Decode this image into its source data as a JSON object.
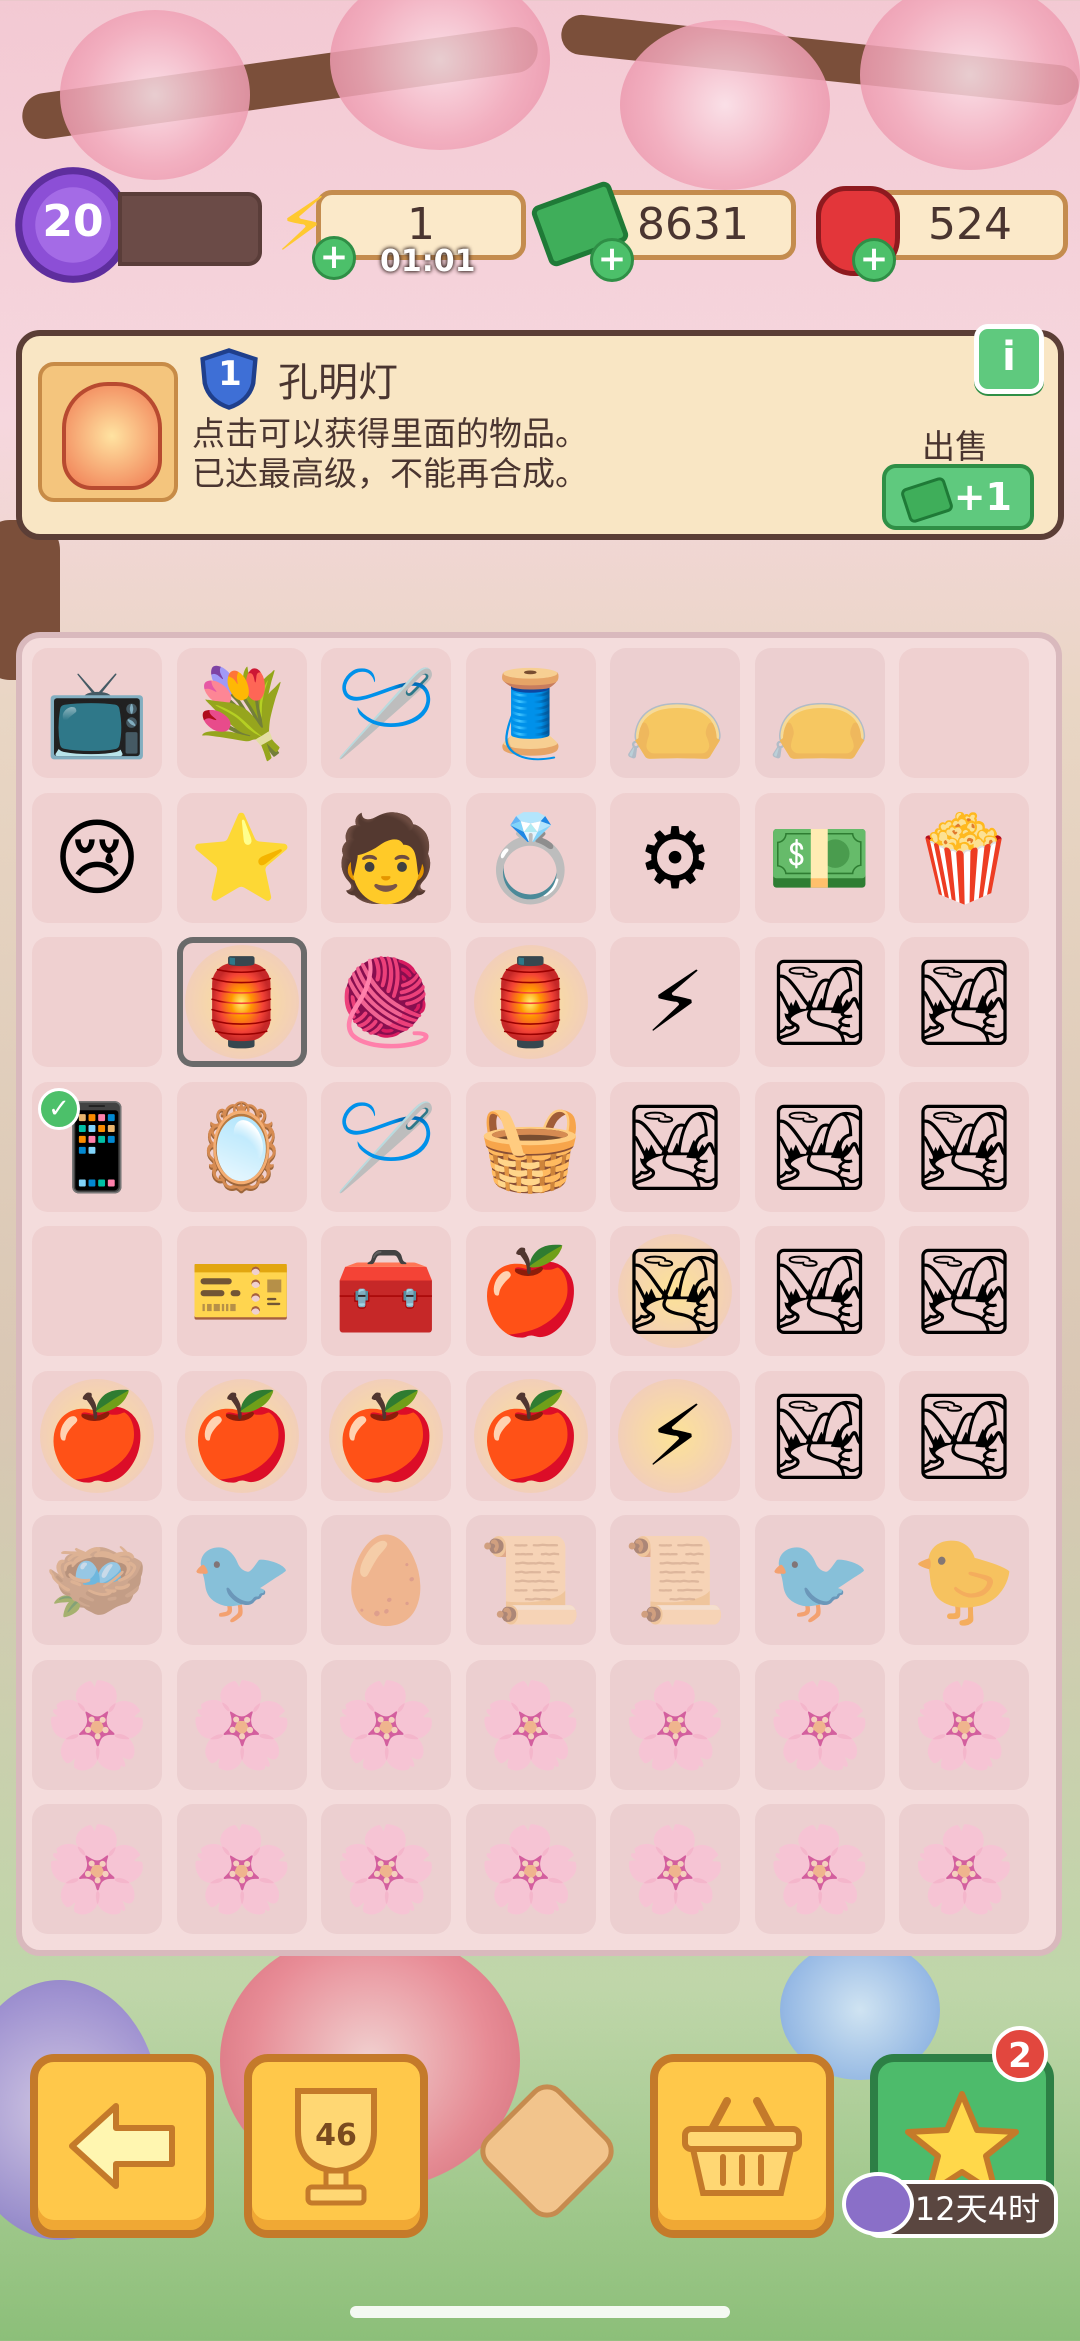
{
  "header": {
    "player_level": "20",
    "energy": "1",
    "energy_timer": "01:01",
    "cash": "8631",
    "gems": "524"
  },
  "item_info": {
    "item_level": "1",
    "name": "孔明灯",
    "desc_line1": "点击可以获得里面的物品。",
    "desc_line2": "已达最高级，不能再合成。",
    "sell_label": "出售",
    "sell_price": "+1",
    "info_button": "i"
  },
  "board": {
    "rows": [
      [
        {
          "name": "tv",
          "icon": "📺"
        },
        {
          "name": "lady-with-flowers",
          "icon": "💐"
        },
        {
          "name": "needle",
          "icon": "🪡"
        },
        {
          "name": "lady-embroidering",
          "icon": "🧵"
        },
        {
          "name": "pouch",
          "icon": "👝",
          "locked": true
        },
        {
          "name": "pouch",
          "icon": "👝",
          "locked": true
        },
        {
          "name": "empty",
          "icon": ""
        }
      ],
      [
        {
          "name": "scholar-crying",
          "icon": "😢"
        },
        {
          "name": "purple-star",
          "icon": "⭐"
        },
        {
          "name": "scholar",
          "icon": "🧑"
        },
        {
          "name": "bracelet",
          "icon": "💍"
        },
        {
          "name": "spinning-wheel",
          "icon": "⚙"
        },
        {
          "name": "cash-stack",
          "icon": "💵"
        },
        {
          "name": "popcorn",
          "icon": "🍿"
        }
      ],
      [
        {
          "name": "empty",
          "icon": ""
        },
        {
          "name": "sky-lantern",
          "icon": "🏮",
          "selected": true,
          "glow": true
        },
        {
          "name": "yarn",
          "icon": "🧶"
        },
        {
          "name": "sky-lantern",
          "icon": "🏮",
          "glow": true
        },
        {
          "name": "waterfall-energy",
          "icon": "⚡"
        },
        {
          "name": "waterfall-girl",
          "icon": "🏞"
        },
        {
          "name": "waterfall-girl",
          "icon": "🏞"
        }
      ],
      [
        {
          "name": "lady-phone",
          "icon": "📱",
          "check": true
        },
        {
          "name": "lady-mirror",
          "icon": "🪞"
        },
        {
          "name": "embroidery-hoop",
          "icon": "🪡"
        },
        {
          "name": "fruit-basket",
          "icon": "🧺"
        },
        {
          "name": "waterfall-girl",
          "icon": "🏞"
        },
        {
          "name": "waterfall-girl",
          "icon": "🏞"
        },
        {
          "name": "waterfall-girl",
          "icon": "🏞"
        }
      ],
      [
        {
          "name": "empty",
          "icon": ""
        },
        {
          "name": "ticket",
          "icon": "🎫"
        },
        {
          "name": "sewing-box",
          "icon": "🧰"
        },
        {
          "name": "fruit-plate",
          "icon": "🍎"
        },
        {
          "name": "waterfall-girl",
          "icon": "🏞",
          "glow": true
        },
        {
          "name": "waterfall-girl",
          "icon": "🏞"
        },
        {
          "name": "waterfall-girl",
          "icon": "🏞"
        }
      ],
      [
        {
          "name": "fruit-plate",
          "icon": "🍎",
          "glow": true
        },
        {
          "name": "fruit-plate",
          "icon": "🍎",
          "glow": true
        },
        {
          "name": "fruit-plate",
          "icon": "🍎",
          "glow": true
        },
        {
          "name": "fruit-plate",
          "icon": "🍎",
          "glow": true
        },
        {
          "name": "waterfall-energy",
          "icon": "⚡",
          "glow": true
        },
        {
          "name": "waterfall-girl",
          "icon": "🏞"
        },
        {
          "name": "waterfall-girl",
          "icon": "🏞"
        }
      ],
      [
        {
          "name": "bird-nest",
          "icon": "🪺",
          "locked": true
        },
        {
          "name": "bird",
          "icon": "🐦",
          "locked": true
        },
        {
          "name": "eggs",
          "icon": "🥚",
          "locked": true
        },
        {
          "name": "scroll",
          "icon": "📜",
          "locked": true
        },
        {
          "name": "scrolls",
          "icon": "📜",
          "locked": true
        },
        {
          "name": "bird",
          "icon": "🐦",
          "locked": true
        },
        {
          "name": "chick",
          "icon": "🐤",
          "locked": true
        }
      ],
      [
        {
          "name": "flower-box",
          "icon": "🌸",
          "locked": true
        },
        {
          "name": "flower-box",
          "icon": "🌸",
          "locked": true
        },
        {
          "name": "flower-box",
          "icon": "🌸",
          "locked": true
        },
        {
          "name": "flower-box",
          "icon": "🌸",
          "locked": true
        },
        {
          "name": "flower-box",
          "icon": "🌸",
          "locked": true
        },
        {
          "name": "flower-box",
          "icon": "🌸",
          "locked": true
        },
        {
          "name": "flower-box",
          "icon": "🌸",
          "locked": true
        }
      ],
      [
        {
          "name": "flower-box",
          "icon": "🌸",
          "locked": true
        },
        {
          "name": "flower-box",
          "icon": "🌸",
          "locked": true
        },
        {
          "name": "flower-box",
          "icon": "🌸",
          "locked": true
        },
        {
          "name": "flower-box",
          "icon": "🌸",
          "locked": true
        },
        {
          "name": "flower-box",
          "icon": "🌸",
          "locked": true
        },
        {
          "name": "flower-box",
          "icon": "🌸",
          "locked": true
        },
        {
          "name": "flower-box",
          "icon": "🌸",
          "locked": true
        }
      ]
    ]
  },
  "bottom": {
    "trophy_count": "46",
    "event_badge": "2",
    "event_timer": "12天4时"
  }
}
